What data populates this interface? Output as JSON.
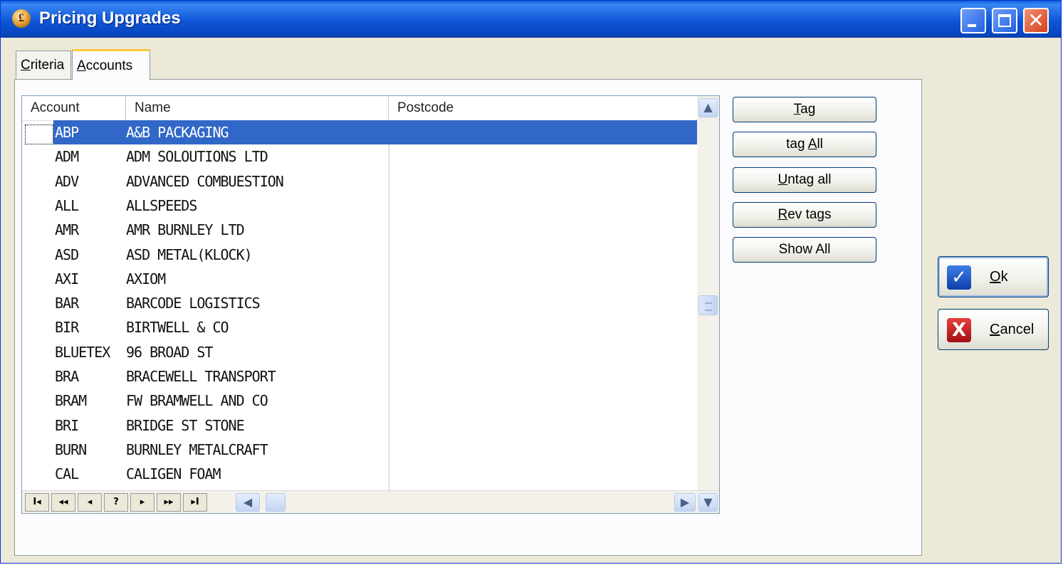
{
  "window": {
    "title": "Pricing Upgrades",
    "app_icon": "£"
  },
  "title_buttons": {
    "minimize_icon": "minimize-icon",
    "maximize_icon": "maximize-icon",
    "close_glyph": "✕"
  },
  "tabs": [
    {
      "key": "C",
      "rest": "riteria",
      "active": false
    },
    {
      "key": "A",
      "rest": "ccounts",
      "active": true
    }
  ],
  "grid": {
    "columns": [
      "Account",
      "Name",
      "Postcode"
    ],
    "selected_index": 0,
    "rows": [
      {
        "account": "ABP",
        "name": "A&B PACKAGING",
        "postcode": ""
      },
      {
        "account": "ADM",
        "name": "ADM SOLOUTIONS LTD",
        "postcode": ""
      },
      {
        "account": "ADV",
        "name": "ADVANCED COMBUESTION",
        "postcode": ""
      },
      {
        "account": "ALL",
        "name": "ALLSPEEDS",
        "postcode": ""
      },
      {
        "account": "AMR",
        "name": "AMR BURNLEY LTD",
        "postcode": ""
      },
      {
        "account": "ASD",
        "name": "ASD METAL(KLOCK)",
        "postcode": ""
      },
      {
        "account": "AXI",
        "name": "AXIOM",
        "postcode": ""
      },
      {
        "account": "BAR",
        "name": "BARCODE LOGISTICS",
        "postcode": ""
      },
      {
        "account": "BIR",
        "name": "BIRTWELL & CO",
        "postcode": ""
      },
      {
        "account": "BLUETEX",
        "name": "96 BROAD ST",
        "postcode": ""
      },
      {
        "account": "BRA",
        "name": "BRACEWELL TRANSPORT",
        "postcode": ""
      },
      {
        "account": "BRAM",
        "name": "FW BRAMWELL AND CO",
        "postcode": ""
      },
      {
        "account": "BRI",
        "name": "BRIDGE ST STONE",
        "postcode": ""
      },
      {
        "account": "BURN",
        "name": "BURNLEY METALCRAFT",
        "postcode": ""
      },
      {
        "account": "CAL",
        "name": "CALIGEN FOAM",
        "postcode": ""
      }
    ],
    "nav_buttons": [
      "I◂",
      "◂◂",
      "◂",
      "?",
      "▸",
      "▸▸",
      "▸I"
    ],
    "scroll_up": "▲",
    "scroll_down": "▼",
    "scroll_left": "◀",
    "scroll_right": "▶"
  },
  "actions": [
    {
      "key": "T",
      "rest": "ag",
      "prefix": ""
    },
    {
      "key": "A",
      "rest": "ll",
      "prefix": "tag "
    },
    {
      "key": "U",
      "rest": "ntag all",
      "prefix": ""
    },
    {
      "key": "R",
      "rest": "ev tags",
      "prefix": ""
    },
    {
      "key": "",
      "rest": "Show All",
      "prefix": ""
    }
  ],
  "ok_button": {
    "key": "O",
    "rest": "k",
    "icon_glyph": "✓"
  },
  "cancel_button": {
    "key": "C",
    "rest": "ancel",
    "icon_glyph": "X"
  }
}
